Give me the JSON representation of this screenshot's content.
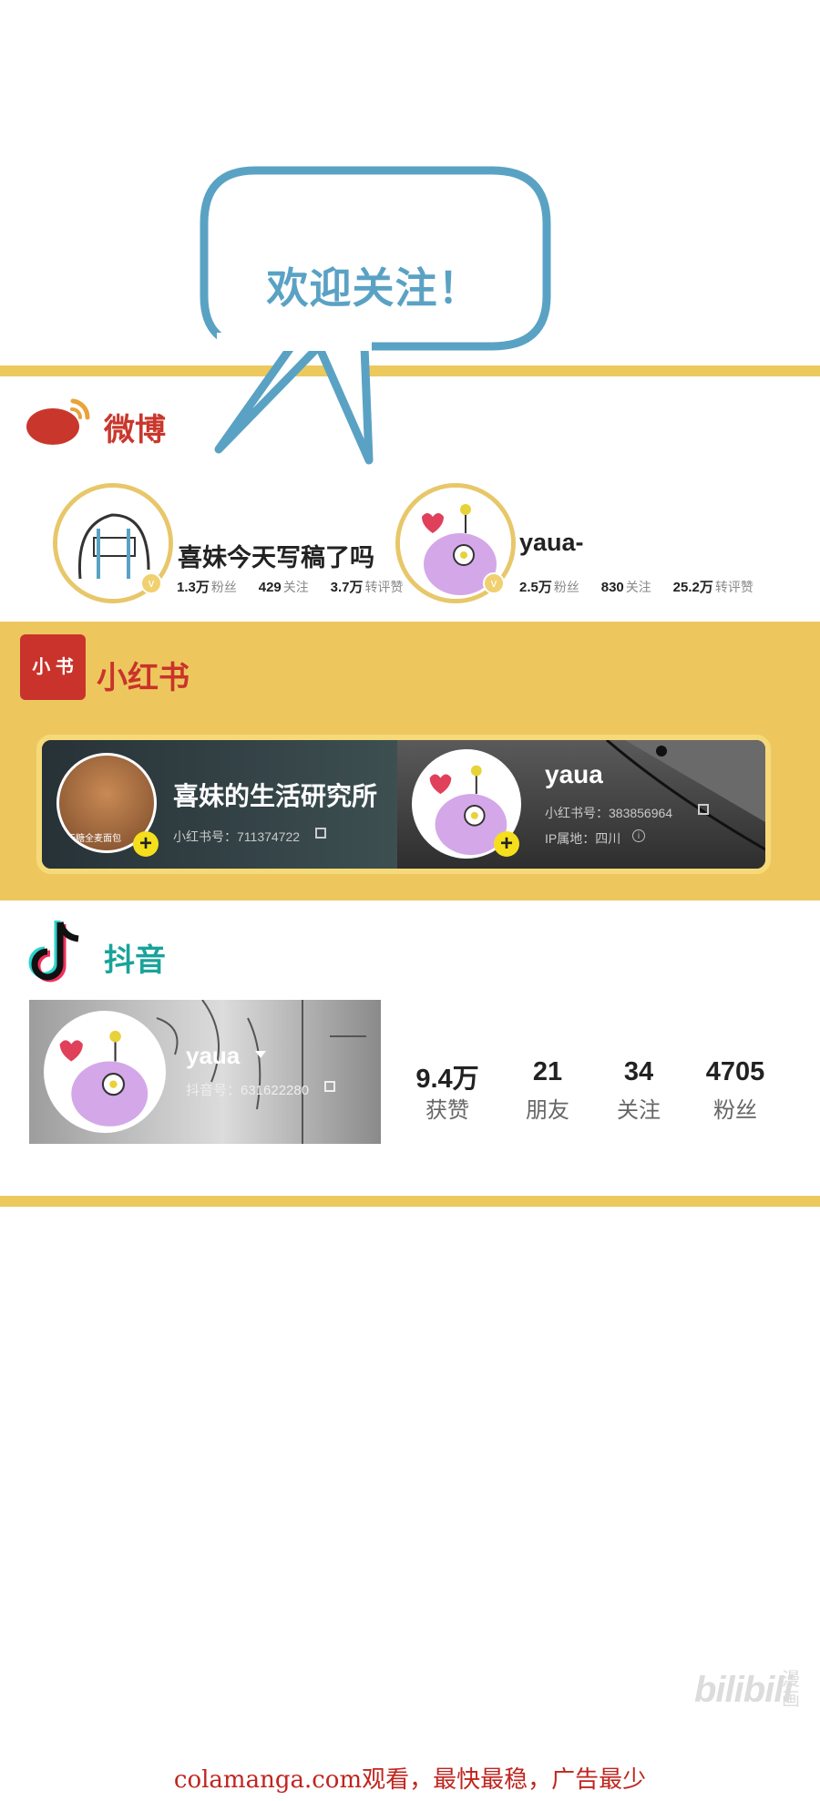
{
  "bubble": {
    "text": "欢迎关注！"
  },
  "weibo": {
    "title": "微博",
    "accounts": [
      {
        "name": "喜妹今天写稿了吗",
        "fans": "1.3万",
        "fans_label": "粉丝",
        "follow": "429",
        "follow_label": "关注",
        "reposts": "3.7万",
        "reposts_label": "转评赞"
      },
      {
        "name": "yaua-",
        "fans": "2.5万",
        "fans_label": "粉丝",
        "follow": "830",
        "follow_label": "关注",
        "reposts": "25.2万",
        "reposts_label": "转评赞"
      }
    ]
  },
  "xiaohongshu": {
    "logo_text": "小 书",
    "title": "小红书",
    "accounts": [
      {
        "name": "喜妹的生活研究所",
        "id": "小红书号：711374722",
        "avatar_caption": "无糖全麦面包"
      },
      {
        "name": "yaua",
        "id": "小红书号：383856964",
        "ip": "IP属地：四川"
      }
    ]
  },
  "douyin": {
    "title": "抖音",
    "name": "yaua",
    "id": "抖音号：631622280",
    "stats": [
      {
        "value": "9.4万",
        "label": "获赞"
      },
      {
        "value": "21",
        "label": "朋友"
      },
      {
        "value": "34",
        "label": "关注"
      },
      {
        "value": "4705",
        "label": "粉丝"
      }
    ]
  },
  "watermark": {
    "logo": "bilibili",
    "sub": "漫画"
  },
  "footer": {
    "text": "colamanga.com观看，最快最稳，广告最少"
  },
  "colors": {
    "accent_yellow": "#ecc95c",
    "bubble_blue": "#5aa2c4",
    "weibo_red": "#c9372c",
    "douyin_teal": "#1aa39a"
  }
}
